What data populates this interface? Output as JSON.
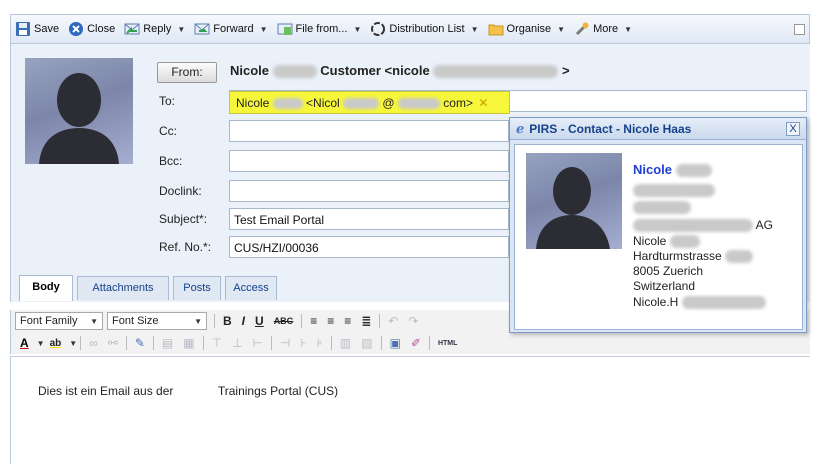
{
  "toolbar": {
    "save": "Save",
    "close": "Close",
    "reply": "Reply",
    "forward": "Forward",
    "file_from": "File from...",
    "distribution_list": "Distribution List",
    "organise": "Organise",
    "more": "More"
  },
  "header": {
    "from_button": "From:",
    "from_name": "Nicole",
    "from_suffix": "Customer <nicole",
    "from_end": ">",
    "to_label": "To:",
    "to_token_name": "Nicole",
    "to_token_addr_start": "<Nicol",
    "to_token_at": "@",
    "to_token_addr_end": "com>",
    "cc_label": "Cc:",
    "bcc_label": "Bcc:",
    "doclink_label": "Doclink:",
    "subject_label": "Subject*:",
    "subject_value": "Test Email Portal",
    "refno_label": "Ref. No.*:",
    "refno_value": "CUS/HZI/00036"
  },
  "tabs": [
    "Body",
    "Attachments",
    "Posts",
    "Access"
  ],
  "editor": {
    "font_family": "Font Family",
    "font_size": "Font Size",
    "body_text_start": "Dies ist ein Email aus der",
    "body_text_end": "Trainings Portal (CUS)"
  },
  "popup": {
    "title": "PIRS - Contact - Nicole Haas",
    "close": "X",
    "name": "Nicole",
    "company_suffix": "AG",
    "contact_first": "Nicole",
    "street": "Hardturmstrasse",
    "city": "8005 Zuerich",
    "country": "Switzerland",
    "email_start": "Nicole.H"
  },
  "colors": {
    "accent": "#15428b",
    "to_highlight": "#f6f63a",
    "header_bg": "#eaf1f9"
  }
}
